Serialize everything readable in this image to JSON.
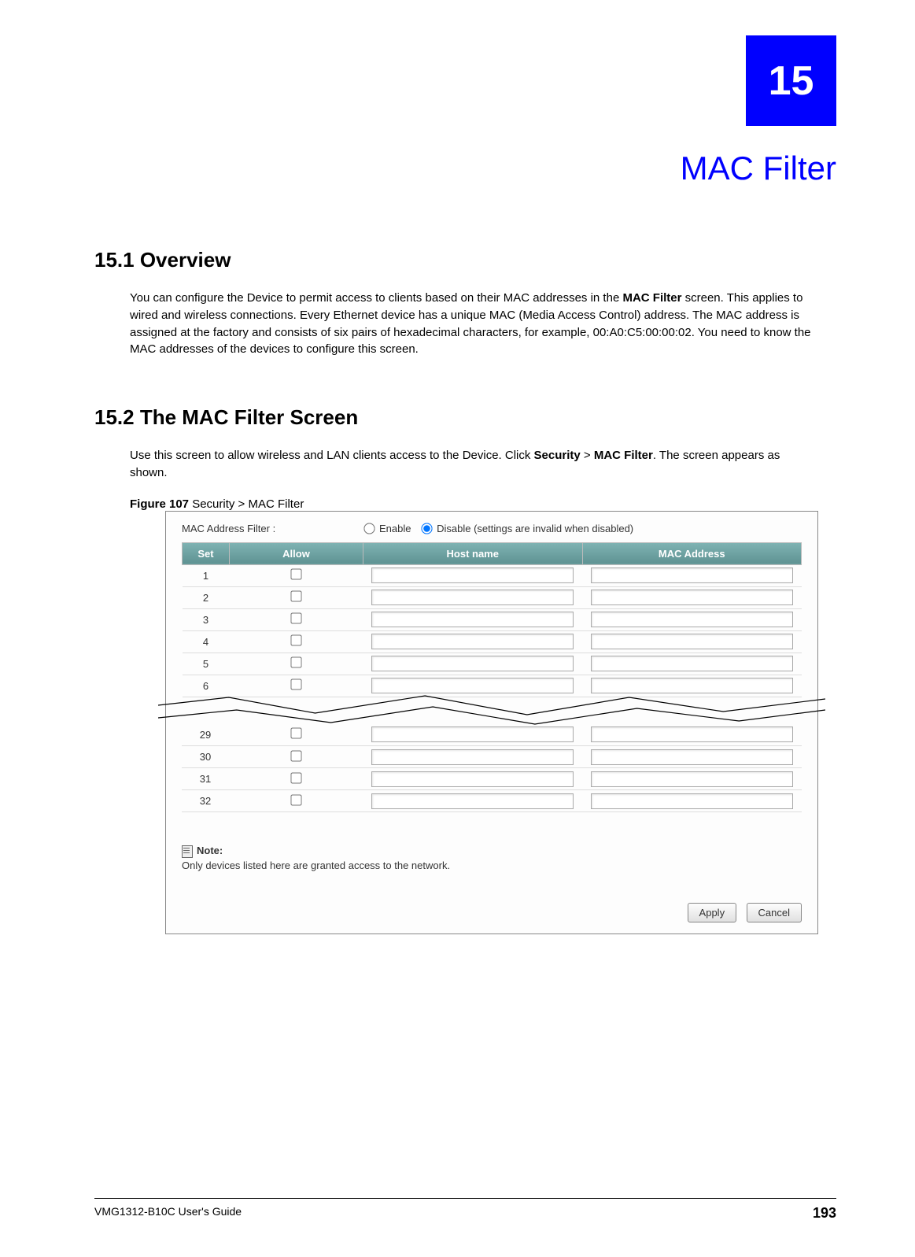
{
  "chapter": {
    "number": "15",
    "title": "MAC Filter"
  },
  "section1": {
    "heading": "15.1  Overview",
    "p1a": "You can configure the Device to permit access to clients based on their MAC addresses in the ",
    "p1b_bold": "MAC Filter",
    "p1c": " screen. This applies to wired and wireless connections. Every Ethernet device has a unique MAC (Media Access Control) address. The MAC address is assigned at the factory and consists of six pairs of hexadecimal characters, for example, 00:A0:C5:00:00:02. You need to know the MAC addresses of the devices to configure this screen."
  },
  "section2": {
    "heading": "15.2  The MAC Filter Screen",
    "p1a": "Use this screen to allow wireless and LAN clients access to the Device. Click ",
    "p1b_bold": "Security",
    "p1c": " > ",
    "p1d_bold": "MAC Filter",
    "p1e": ". The screen appears as shown."
  },
  "figure": {
    "label": "Figure 107",
    "caption": "   Security > MAC Filter"
  },
  "ui": {
    "filter_label": "MAC Address Filter :",
    "enable": "Enable",
    "disable": "Disable (settings are invalid when disabled)",
    "columns": {
      "set": "Set",
      "allow": "Allow",
      "host": "Host name",
      "mac": "MAC Address"
    },
    "rows_top": [
      "1",
      "2",
      "3",
      "4",
      "5",
      "6"
    ],
    "rows_bottom": [
      "29",
      "30",
      "31",
      "32"
    ],
    "note_label": "Note:",
    "note_text": "Only devices listed here are granted access to the network.",
    "apply": "Apply",
    "cancel": "Cancel"
  },
  "footer": {
    "guide": "VMG1312-B10C User's Guide",
    "page": "193"
  }
}
